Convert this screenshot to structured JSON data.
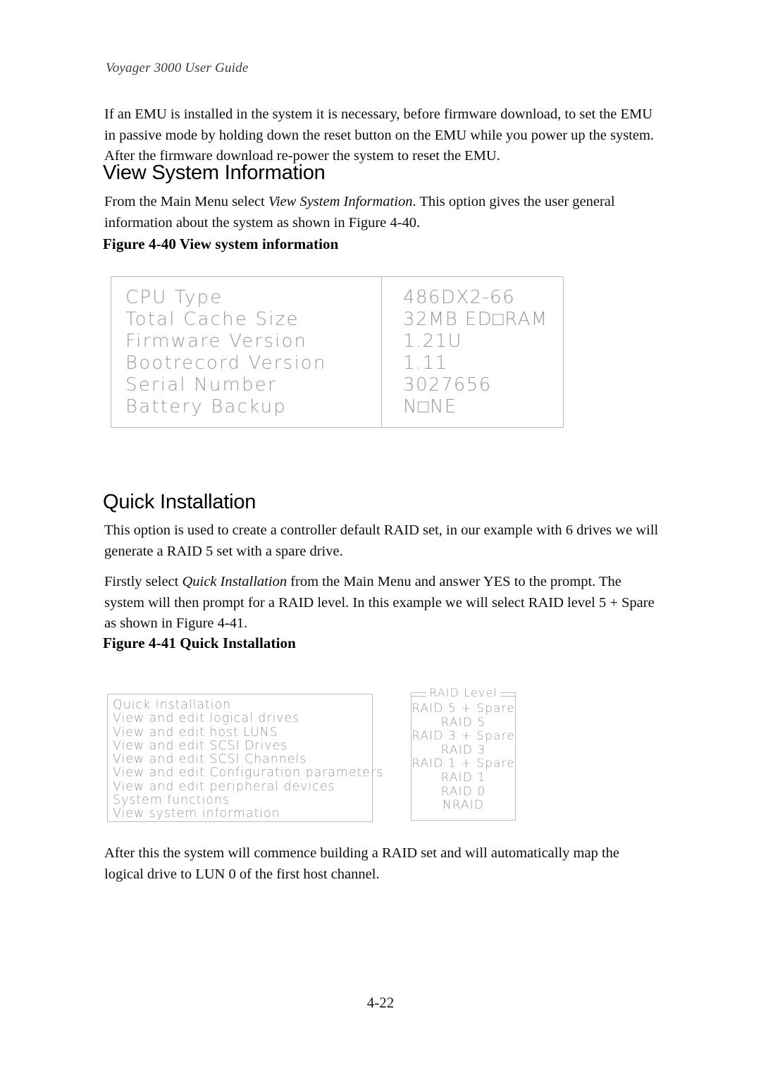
{
  "document": {
    "running_header": "Voyager 3000 User Guide",
    "page_number": "4-22"
  },
  "intro_paragraph": {
    "text": "If an EMU is installed in the system it is necessary, before firmware download, to set the EMU in passive mode by holding down the reset button on the EMU while you power up the system. After the firmware download re-power the system to reset the EMU."
  },
  "section_view_system_information": {
    "heading": "View System Information",
    "paragraph_part1": "From the Main Menu select ",
    "paragraph_italic": "View System Information",
    "paragraph_part2": ". This option gives the user general information about the system as shown in Figure 4-40.",
    "figure_caption": "Figure 4-40 View system information",
    "figure": {
      "rows": [
        {
          "label": "CPU Type",
          "value": "486DX2-66"
        },
        {
          "label": "Total Cache Size",
          "value": "32MB ED□RAM"
        },
        {
          "label": "Firmware Version",
          "value": "1.21U"
        },
        {
          "label": "Bootrecord Version",
          "value": "1.11"
        },
        {
          "label": "Serial Number",
          "value": "3027656"
        },
        {
          "label": "Battery Backup",
          "value": "N□NE"
        }
      ]
    }
  },
  "section_quick_installation": {
    "heading": "Quick Installation",
    "paragraph1": "This option is used to create a controller default RAID set, in our example with 6 drives we will generate a RAID 5 set with a spare drive.",
    "paragraph2_part1": "Firstly select ",
    "paragraph2_italic": "Quick Installation",
    "paragraph2_part2": " from the Main Menu and answer YES to the prompt. The system will then prompt for a RAID level. In this example we will select RAID level 5 + Spare as shown in Figure 4-41.",
    "figure_caption": "Figure 4-41 Quick Installation",
    "main_menu": {
      "items": [
        "Quick Installation",
        "View and edit logical drives",
        "View and edit host LUNS",
        "View and edit SCSI Drives",
        "View and edit SCSI Channels",
        "View and edit Configuration parameters",
        "View and edit peripheral devices",
        "System functions",
        "View system information"
      ]
    },
    "raid_level_dialog": {
      "title": "RAID Level",
      "options": [
        "RAID 5 + Spare",
        "RAID 5",
        "RAID 3 + Spare",
        "RAID 3",
        "RAID 1 + Spare",
        "RAID 1",
        "RAID 0",
        "NRAID"
      ]
    },
    "closing_paragraph": "After this the system will commence building a RAID set and will automatically map the logical drive to LUN 0 of the first host channel."
  },
  "colors": {
    "figure_text": "#9a9a9a",
    "figure_border": "#bdbdbd",
    "body_text": "#0d0d0d",
    "header_text": "#3a3a3a"
  }
}
